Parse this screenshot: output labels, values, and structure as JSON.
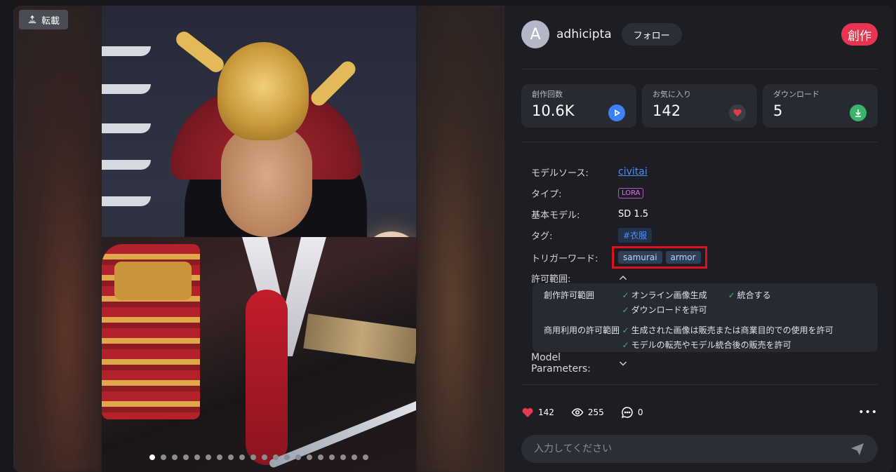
{
  "viewer": {
    "repost_label": "転載",
    "slide_count": 20,
    "active_slide": 1
  },
  "author": {
    "avatar_letter": "A",
    "name": "adhicipta",
    "follow_label": "フォロー"
  },
  "create_label": "創作",
  "stats": [
    {
      "label": "創作回数",
      "value": "10.6K",
      "icon": "play-icon",
      "color": "#3b82f6"
    },
    {
      "label": "お気に入り",
      "value": "142",
      "icon": "heart-icon",
      "color": "#e23b4a"
    },
    {
      "label": "ダウンロード",
      "value": "5",
      "icon": "download-icon",
      "color": "#3bb36a"
    }
  ],
  "props": {
    "source_label": "モデルソース:",
    "source_value": "civitai",
    "type_label": "タイプ:",
    "type_value": "LORA",
    "base_label": "基本モデル:",
    "base_value": "SD 1.5",
    "tag_label": "タグ:",
    "tag_value": "#衣服",
    "trigger_label": "トリガーワード:",
    "triggers": [
      "samurai",
      "armor"
    ],
    "license_label": "許可範囲:"
  },
  "license": {
    "creation_label": "創作許可範囲",
    "creation_items": [
      "オンライン画像生成",
      "統合する",
      "ダウンロードを許可"
    ],
    "commercial_label": "商用利用の許可範囲",
    "commercial_items": [
      "生成された画像は販売または商業目的での使用を許可",
      "モデルの転売やモデル統合後の販売を許可"
    ]
  },
  "model_params_label": "Model Parameters:",
  "actions": {
    "likes": "142",
    "views": "255",
    "comments": "0",
    "more": "•••"
  },
  "comment": {
    "placeholder": "入力してください"
  }
}
